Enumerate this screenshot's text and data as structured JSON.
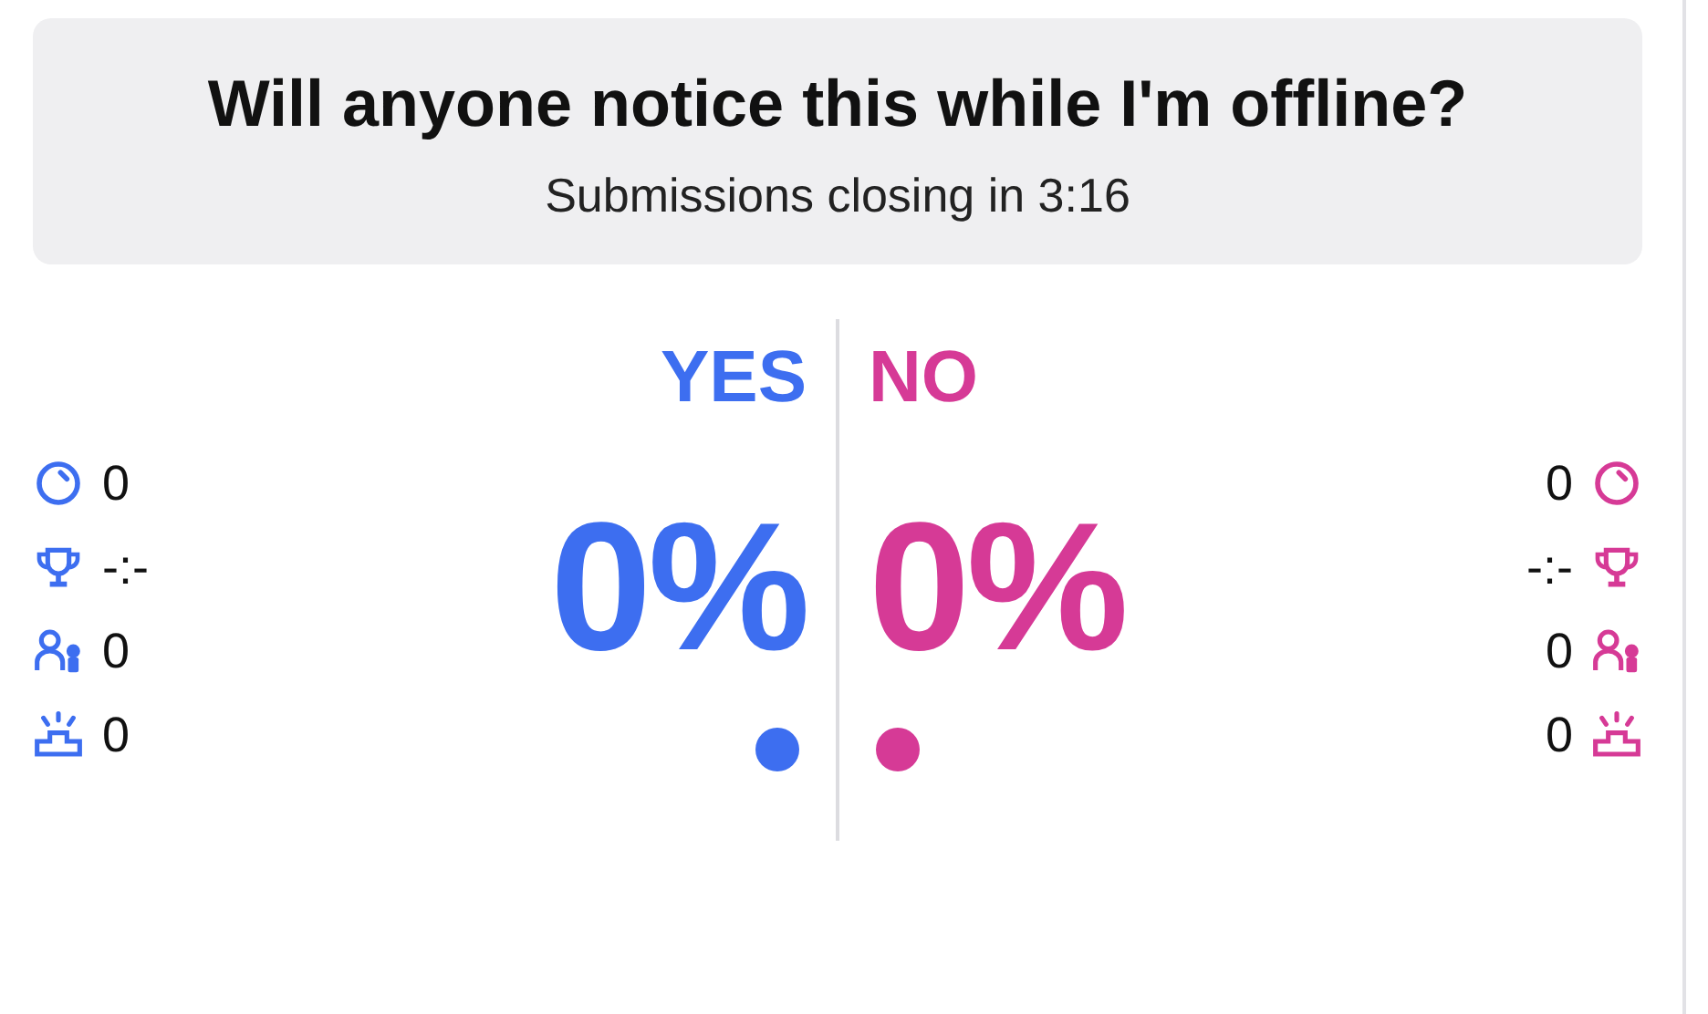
{
  "prediction": {
    "question": "Will anyone notice this while I'm offline?",
    "status": "Submissions closing in 3:16"
  },
  "outcomes": [
    {
      "label": "YES",
      "percent": "0%",
      "color": "#3d6ef0",
      "stats": [
        {
          "kind": "timer",
          "value": "0"
        },
        {
          "kind": "trophy",
          "value": "-:-"
        },
        {
          "kind": "users",
          "value": "0"
        },
        {
          "kind": "podium",
          "value": "0"
        }
      ]
    },
    {
      "label": "NO",
      "percent": "0%",
      "color": "#d63a96",
      "stats": [
        {
          "kind": "timer",
          "value": "0"
        },
        {
          "kind": "trophy",
          "value": "-:-"
        },
        {
          "kind": "users",
          "value": "0"
        },
        {
          "kind": "podium",
          "value": "0"
        }
      ]
    }
  ]
}
